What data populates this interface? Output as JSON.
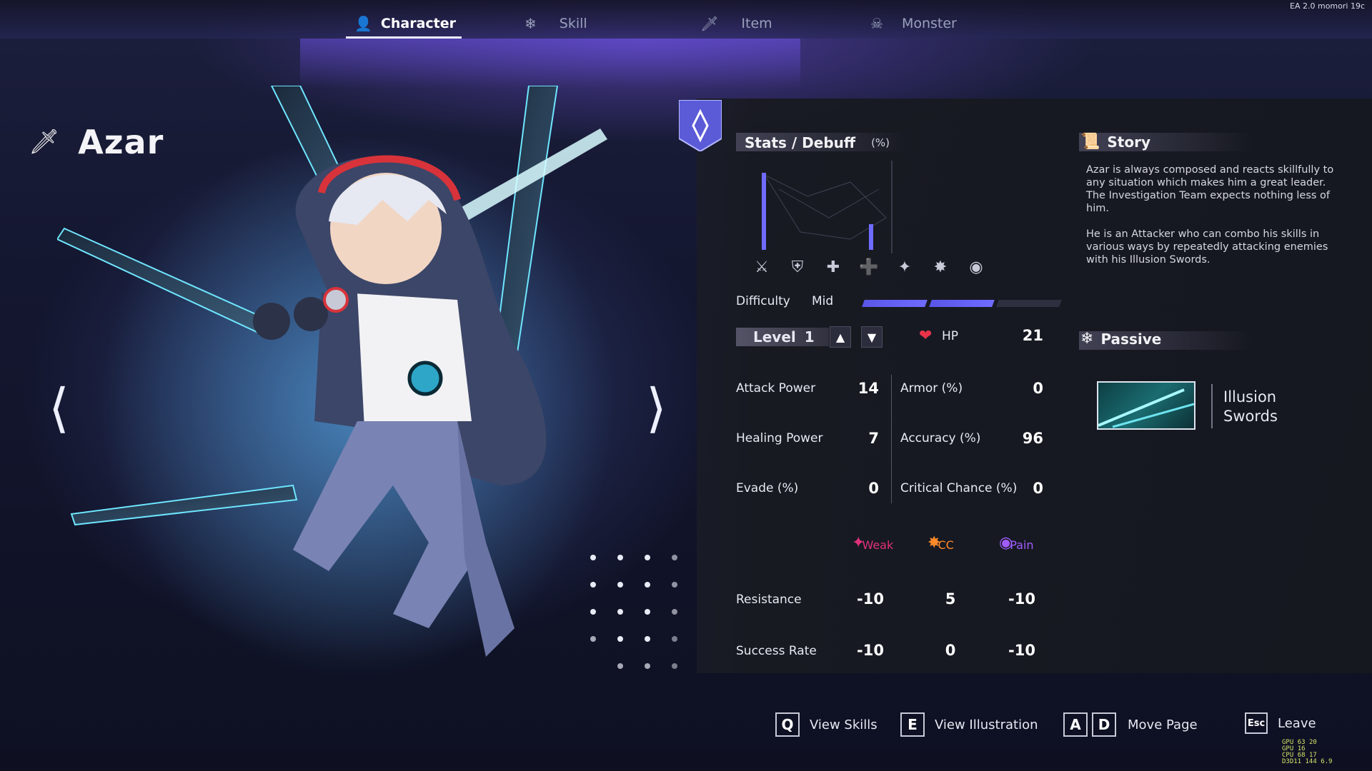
{
  "tabs": [
    {
      "label": "Character",
      "icon": "person-icon",
      "active": true
    },
    {
      "label": "Skill",
      "icon": "swirl-sword-icon",
      "active": false
    },
    {
      "label": "Item",
      "icon": "dagger-icon",
      "active": false
    },
    {
      "label": "Monster",
      "icon": "skull-icon",
      "active": false
    }
  ],
  "version": "EA 2.0 momori 19c",
  "character": {
    "name": "Azar"
  },
  "stats_section": {
    "title": "Stats / Debuff",
    "unit": "(%)"
  },
  "difficulty": {
    "label": "Difficulty",
    "value": "Mid",
    "filled": 2,
    "total": 3
  },
  "level": {
    "label": "Level",
    "value": "1"
  },
  "hp": {
    "label": "HP",
    "value": "21"
  },
  "stats": {
    "attack_power": {
      "label": "Attack Power",
      "value": "14"
    },
    "healing_power": {
      "label": "Healing Power",
      "value": "7"
    },
    "evade": {
      "label": "Evade (%)",
      "value": "0"
    },
    "armor": {
      "label": "Armor (%)",
      "value": "0"
    },
    "accuracy": {
      "label": "Accuracy (%)",
      "value": "96"
    },
    "critical": {
      "label": "Critical Chance (%)",
      "value": "0"
    }
  },
  "debuffs": [
    {
      "label": "Weak",
      "color": "#e0307a"
    },
    {
      "label": "CC",
      "color": "#ff8a2a"
    },
    {
      "label": "Pain",
      "color": "#a15cff"
    }
  ],
  "resistance": {
    "label": "Resistance",
    "values": [
      "-10",
      "5",
      "-10"
    ]
  },
  "success_rate": {
    "label": "Success Rate",
    "values": [
      "-10",
      "0",
      "-10"
    ]
  },
  "story": {
    "title": "Story",
    "paragraphs": [
      "Azar is always composed and reacts skillfully to any situation which makes him a great leader. The Investigation Team expects nothing less of him.",
      "He is an Attacker who can combo his skills in various ways by repeatedly attacking enemies with his Illusion Swords."
    ]
  },
  "passive": {
    "title": "Passive",
    "name_line1": "Illusion",
    "name_line2": "Swords"
  },
  "footer": [
    {
      "keys": [
        "Q"
      ],
      "label": "View Skills"
    },
    {
      "keys": [
        "E"
      ],
      "label": "View Illustration"
    },
    {
      "keys": [
        "A",
        "D"
      ],
      "label": "Move Page"
    },
    {
      "keys": [
        "Esc"
      ],
      "label": "Leave"
    }
  ],
  "stat_bars": [
    0.9,
    0,
    0,
    0.3,
    0,
    0,
    0
  ],
  "colors": {
    "accent": "#6f6bff",
    "bar_empty": "#2e3040",
    "hp_heart": "#e8334a"
  },
  "perf_overlay": {
    "rows": [
      {
        "label": "GPU",
        "value1": "63",
        "value2": "20"
      },
      {
        "label": "GPU",
        "value1": "16",
        "value2": ""
      },
      {
        "label": "CPU",
        "value1": "68",
        "value2": "17"
      },
      {
        "label": "D3D11",
        "value1": "144",
        "value2": "6.9"
      }
    ]
  }
}
